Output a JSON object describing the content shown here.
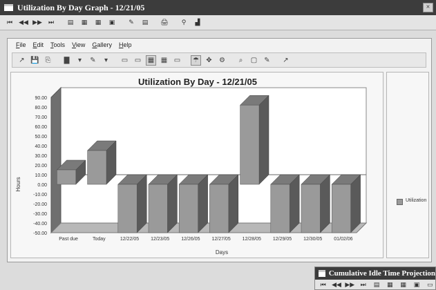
{
  "outer_window": {
    "title": "Utilization By Day Graph - 12/21/05",
    "close": "×",
    "toolbar": [
      "⏮",
      "◀◀",
      "▶▶",
      "⏭",
      "▤",
      "▦",
      "▦",
      "▣",
      "✎",
      "▤",
      "🖨",
      "⚲",
      "▟"
    ]
  },
  "menu": [
    {
      "acc": "F",
      "rest": "ile"
    },
    {
      "acc": "E",
      "rest": "dit"
    },
    {
      "acc": "T",
      "rest": "ools"
    },
    {
      "acc": "V",
      "rest": "iew"
    },
    {
      "acc": "G",
      "rest": "allery"
    },
    {
      "acc": "H",
      "rest": "elp"
    }
  ],
  "inner_toolbar": [
    "↗",
    "💾",
    "⎘",
    "▇",
    "▾",
    "✎",
    "▾",
    "▭",
    "▭",
    "▦",
    "▦",
    "▭",
    "☂",
    "✥",
    "⚙",
    "⌕",
    "▢",
    "✎",
    "↗"
  ],
  "chart_data": {
    "type": "bar",
    "title": "Utilization By Day  - 12/21/05",
    "xlabel": "Days",
    "ylabel": "Hours",
    "ylim": [
      -50,
      90
    ],
    "yticks": [
      "90.00",
      "80.00",
      "70.00",
      "60.00",
      "50.00",
      "40.00",
      "30.00",
      "20.00",
      "10.00",
      "0.00",
      "-10.00",
      "-20.00",
      "-30.00",
      "-40.00",
      "-50.00"
    ],
    "categories": [
      "Past due",
      "Today",
      "12/22/05",
      "12/23/05",
      "12/26/05",
      "12/27/05",
      "12/28/05",
      "12/29/05",
      "12/30/05",
      "01/02/06"
    ],
    "series": [
      {
        "name": "Utilization",
        "values": [
          15,
          35,
          -50,
          -50,
          -50,
          -50,
          82,
          -50,
          -50,
          -50
        ],
        "color": "#9a9a9a"
      }
    ],
    "legend": "right"
  },
  "popup": {
    "title": "Cumulative Idle Time Projection",
    "toolbar": [
      "⏮",
      "◀◀",
      "▶▶",
      "⏭",
      "▤",
      "▦",
      "▦",
      "▣",
      "▭"
    ]
  }
}
